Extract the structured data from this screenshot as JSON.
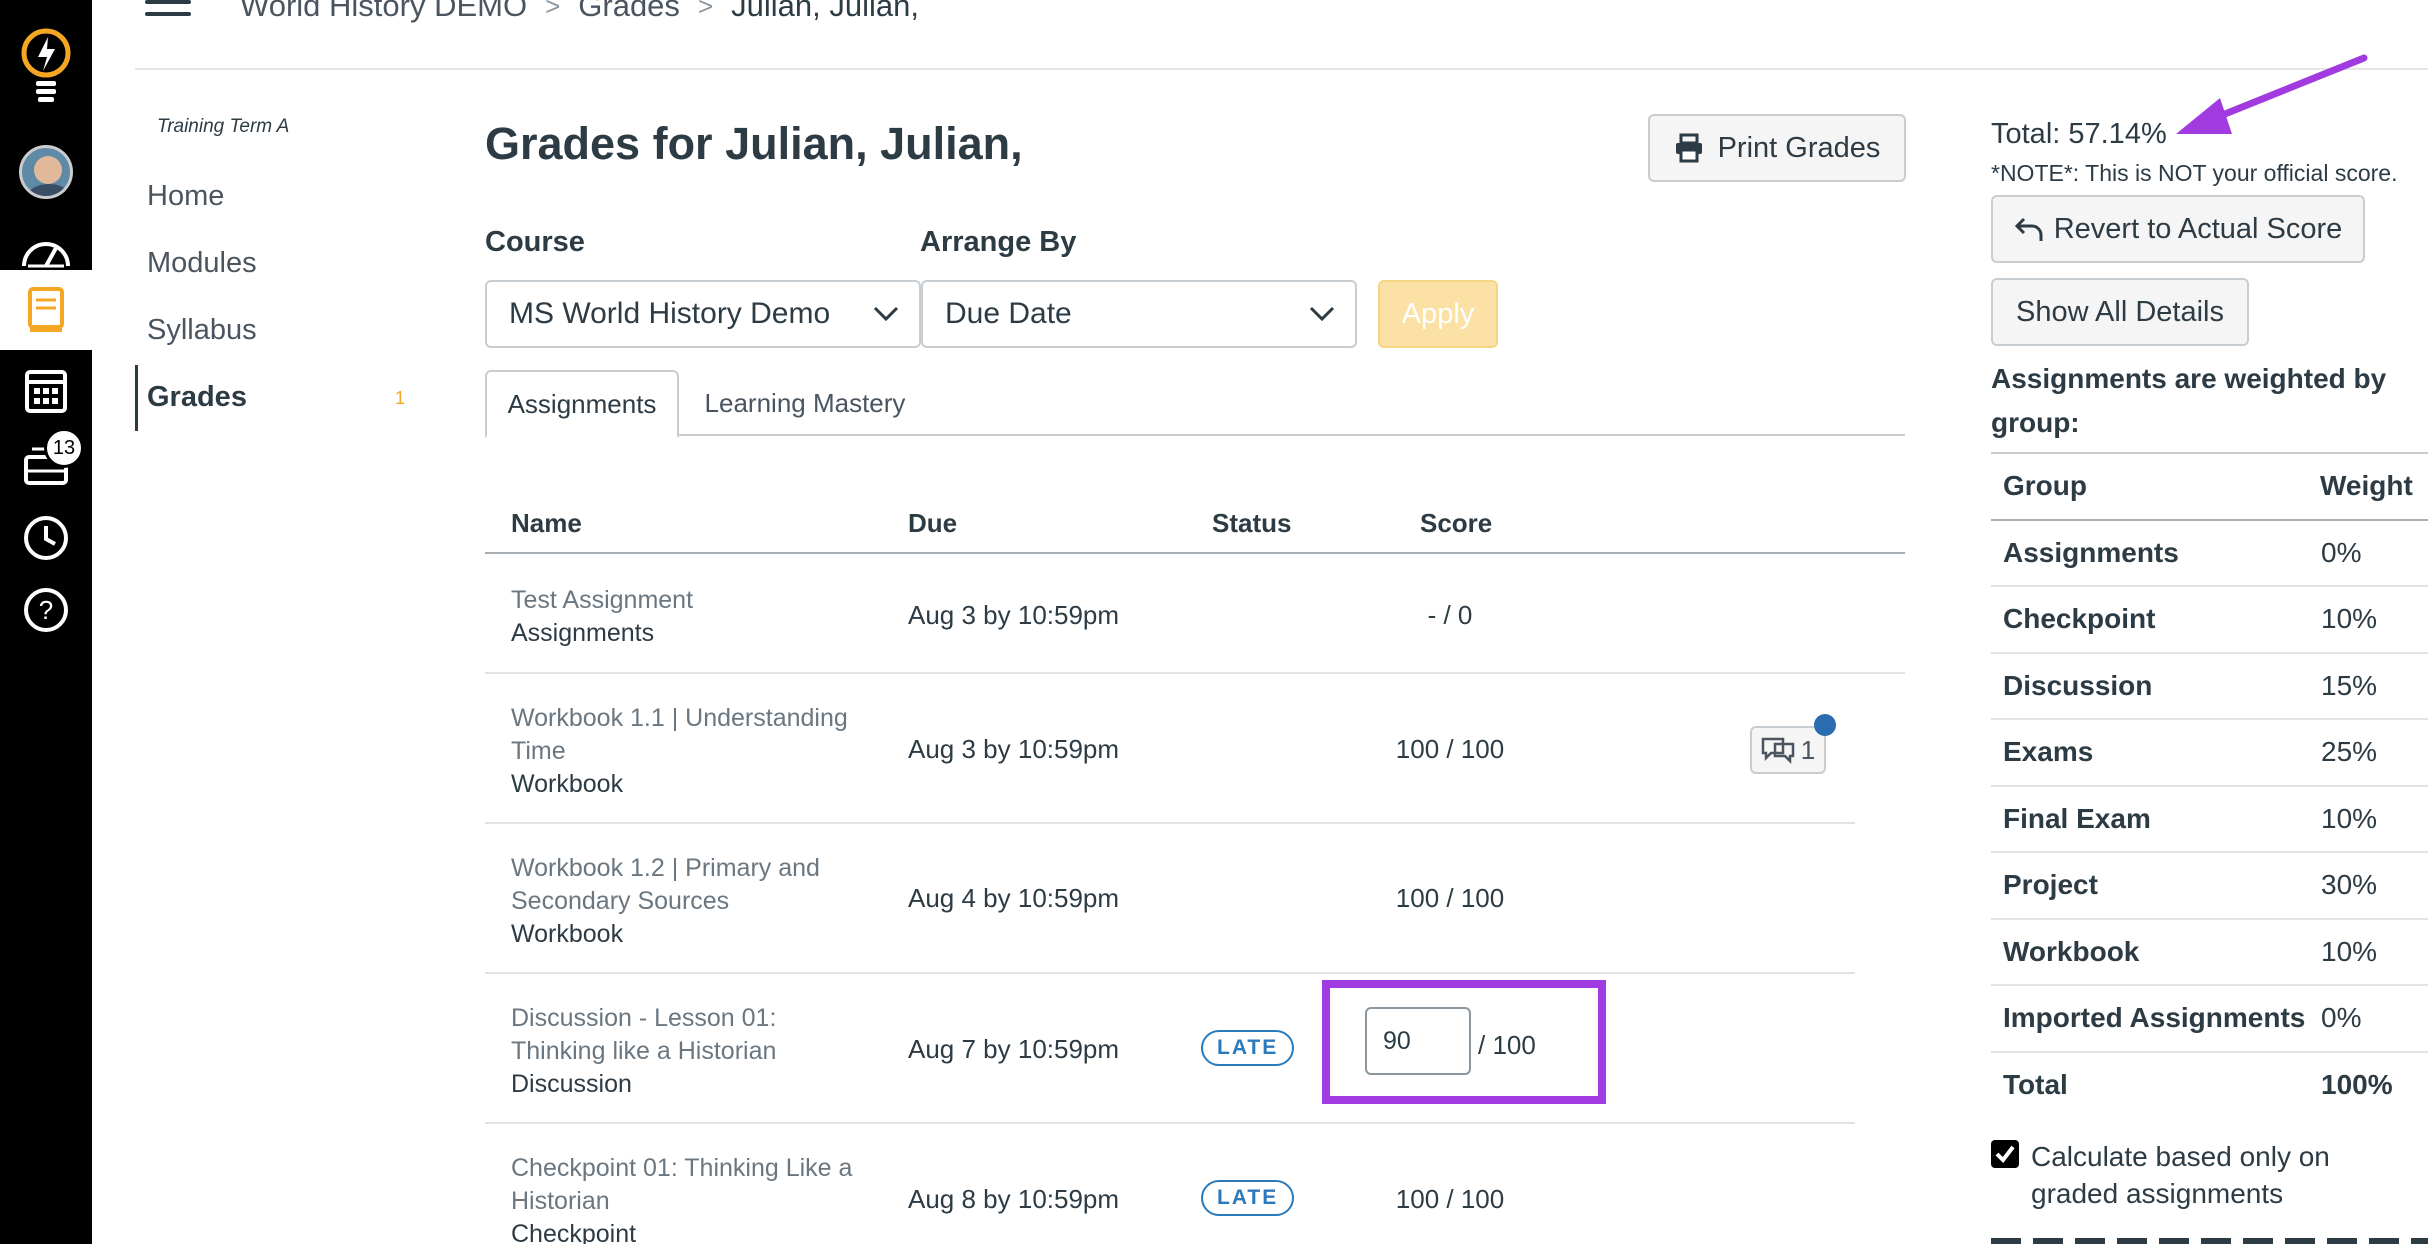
{
  "colors": {
    "nav_bg": "#000000",
    "accent_late": "#2b7abc",
    "highlight": "#a13be0",
    "apply_disabled": "#fbe1a5",
    "count_badge": "#f5a623"
  },
  "global_nav": {
    "items": [
      {
        "name": "logo",
        "icon": "lightbulb-icon"
      },
      {
        "name": "account",
        "icon": "avatar"
      },
      {
        "name": "dashboard",
        "icon": "dashboard-icon"
      },
      {
        "name": "courses",
        "icon": "book-icon",
        "active": true
      },
      {
        "name": "calendar",
        "icon": "calendar-icon"
      },
      {
        "name": "inbox",
        "icon": "inbox-icon",
        "badge": "13"
      },
      {
        "name": "history",
        "icon": "clock-icon"
      },
      {
        "name": "help",
        "icon": "help-icon"
      }
    ]
  },
  "header": {
    "breadcrumb": [
      "World History DEMO",
      "Grades",
      "Julian, Julian,"
    ]
  },
  "course_nav": {
    "term": "Training Term A",
    "links": [
      "Home",
      "Modules",
      "Syllabus",
      "Grades"
    ],
    "active": "Grades",
    "grades_count": "1"
  },
  "main": {
    "title": "Grades for Julian, Julian,",
    "print_label": "Print Grades",
    "course_label": "Course",
    "course_value": "MS World History Demo",
    "arrange_label": "Arrange By",
    "arrange_value": "Due Date",
    "apply_label": "Apply",
    "tabs": [
      "Assignments",
      "Learning Mastery"
    ],
    "active_tab": "Assignments",
    "columns": [
      "Name",
      "Due",
      "Status",
      "Score"
    ],
    "rows": [
      {
        "title": "Test Assignment",
        "group": "Assignments",
        "due": "Aug 3 by 10:59pm",
        "status": "",
        "score": "- / 0"
      },
      {
        "title": "Workbook 1.1 | Understanding Time",
        "group": "Workbook",
        "due": "Aug 3 by 10:59pm",
        "status": "",
        "score": "100 / 100",
        "comments": "1"
      },
      {
        "title": "Workbook 1.2 | Primary and Secondary Sources",
        "group": "Workbook",
        "due": "Aug 4 by 10:59pm",
        "status": "",
        "score": "100 / 100"
      },
      {
        "title": "Discussion - Lesson 01: Thinking like a Historian",
        "group": "Discussion",
        "due": "Aug 7 by 10:59pm",
        "status": "LATE",
        "score_input": "90",
        "score_of": "/ 100"
      },
      {
        "title": "Checkpoint 01: Thinking Like a Historian",
        "group": "Checkpoint",
        "due": "Aug 8 by 10:59pm",
        "status": "LATE",
        "score": "100 / 100"
      }
    ]
  },
  "sidebar": {
    "total": "Total: 57.14%",
    "note": "*NOTE*: This is NOT your official score.",
    "revert_label": "Revert to Actual Score",
    "show_details_label": "Show All Details",
    "weighted_title": "Assignments are weighted by group:",
    "weights_header": {
      "group": "Group",
      "weight": "Weight"
    },
    "weights": [
      {
        "group": "Assignments",
        "weight": "0%"
      },
      {
        "group": "Checkpoint",
        "weight": "10%"
      },
      {
        "group": "Discussion",
        "weight": "15%"
      },
      {
        "group": "Exams",
        "weight": "25%"
      },
      {
        "group": "Final Exam",
        "weight": "10%"
      },
      {
        "group": "Project",
        "weight": "30%"
      },
      {
        "group": "Workbook",
        "weight": "10%"
      },
      {
        "group": "Imported Assignments",
        "weight": "0%"
      },
      {
        "group": "Total",
        "weight": "100%"
      }
    ],
    "calc_checkbox_checked": true,
    "calc_checkbox_label": "Calculate based only on graded assignments"
  }
}
